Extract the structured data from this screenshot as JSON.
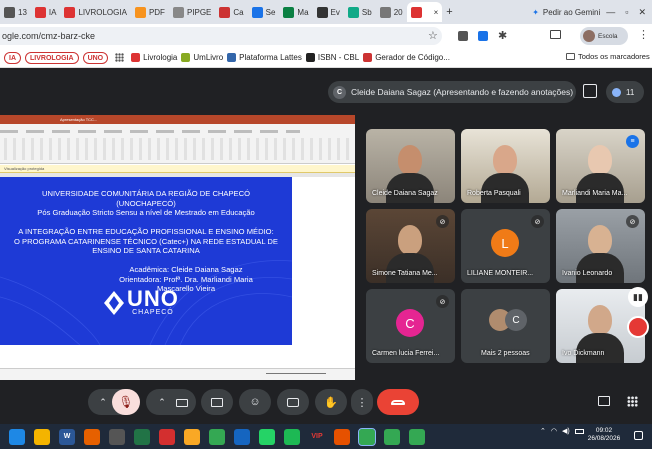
{
  "browser": {
    "tabs": [
      {
        "label": "13",
        "color": "#555"
      },
      {
        "label": "IA",
        "color": "#d33"
      },
      {
        "label": "LIVROLOGIA",
        "color": "#d33"
      },
      {
        "label": "PDF",
        "color": "#f7931e"
      },
      {
        "label": "PIPGE",
        "color": "#888"
      },
      {
        "label": "Ca",
        "color": "#c33"
      },
      {
        "label": "Se",
        "color": "#1a73e8"
      },
      {
        "label": "Ma",
        "color": "#0b8043"
      },
      {
        "label": "Ev",
        "color": "#333"
      },
      {
        "label": "Sb",
        "color": "#1a8"
      },
      {
        "label": "20",
        "color": "#777"
      },
      {
        "label": "",
        "color": "#d33"
      }
    ],
    "gemini_label": "Pedir ao Gemini",
    "url": "ogle.com/cmz-barz-cke",
    "profile_label": "Escola",
    "bookmarks": [
      {
        "label": "IA",
        "type": "pill"
      },
      {
        "label": "LIVROLOGIA",
        "type": "pill"
      },
      {
        "label": "UNO",
        "type": "pill"
      },
      {
        "label": "Livrologia",
        "color": "#d33"
      },
      {
        "label": "UmLivro",
        "color": "#8a2"
      },
      {
        "label": "Plataforma Lattes",
        "color": "#36a"
      },
      {
        "label": "ISBN - CBL",
        "color": "#222"
      },
      {
        "label": "Gerador de Código...",
        "color": "#c33"
      }
    ],
    "all_bookmarks_label": "Todos os marcadores"
  },
  "meet": {
    "presenter_initial": "C",
    "presenter_label": "Cleide Daiana Sagaz (Apresentando e fazendo anotações)",
    "participant_count": "11",
    "participants": [
      {
        "name": "Cleide Daiana Sagaz",
        "type": "video",
        "muted": false
      },
      {
        "name": "Roberta Pasquali",
        "type": "video",
        "muted": false
      },
      {
        "name": "Marliandi Maria Ma...",
        "type": "video",
        "muted": false
      },
      {
        "name": "Simone Tatiana Me...",
        "type": "video",
        "muted": true
      },
      {
        "name": "LILIANE MONTEIR...",
        "type": "avatar",
        "initial": "L",
        "avatar_color": "#f07b17",
        "muted": true
      },
      {
        "name": "Ivanio Leonardo",
        "type": "video",
        "muted": true
      },
      {
        "name": "Carmen lucia Ferrei...",
        "type": "avatar",
        "initial": "C",
        "avatar_color": "#e52592",
        "muted": true
      },
      {
        "name": "Mais 2 pessoas",
        "type": "more",
        "initial": "C"
      },
      {
        "name": "Ivo Dickmann",
        "type": "video",
        "muted": false
      }
    ]
  },
  "ppt": {
    "window_title": "Apresentação TCC...",
    "notice": "Visualização protegida",
    "slide_lines": [
      "UNIVERSIDADE COMUNITÁRIA DA REGIÃO DE CHAPECÓ",
      "(UNOCHAPECÓ)",
      "Pós Graduação Stricto Sensu a nível de Mestrado em Educação",
      "",
      "A INTEGRAÇÃO ENTRE EDUCAÇÃO PROFISSIONAL E ENSINO MÉDIO:",
      "O PROGRAMA CATARINENSE TÉCNICO (Catec+) NA REDE ESTADUAL DE",
      "ENSINO DE SANTA CATARINA",
      "",
      "Acadêmica: Cleide Daiana Sagaz",
      "Orientadora: Profª. Dra. Marliandi Maria",
      "Mascarello Vieira"
    ],
    "logo_text": "UNO",
    "logo_sub": "CHAPECÓ"
  },
  "taskbar": {
    "time": "09:02",
    "date": "26/08/2026",
    "icons": [
      {
        "name": "windows-start-icon",
        "color": "#1e88e5",
        "label": ""
      },
      {
        "name": "store-icon",
        "color": "#f4b400",
        "label": ""
      },
      {
        "name": "word-icon",
        "color": "#2b5797",
        "label": "W"
      },
      {
        "name": "firefox-icon",
        "color": "#e66000",
        "label": ""
      },
      {
        "name": "calculator-icon",
        "color": "#555",
        "label": ""
      },
      {
        "name": "excel-icon",
        "color": "#217346",
        "label": ""
      },
      {
        "name": "acrobat-icon",
        "color": "#d32f2f",
        "label": ""
      },
      {
        "name": "explorer-icon",
        "color": "#f9a825",
        "label": ""
      },
      {
        "name": "chrome-icon",
        "color": "#34a853",
        "label": ""
      },
      {
        "name": "snipping-icon",
        "color": "#1565c0",
        "label": ""
      },
      {
        "name": "whatsapp-icon",
        "color": "#25d366",
        "label": ""
      },
      {
        "name": "spotify-icon",
        "color": "#1db954",
        "label": ""
      },
      {
        "name": "vip-icon",
        "color": "#1f2a3a",
        "label": "VIP"
      },
      {
        "name": "app-icon",
        "color": "#e65100",
        "label": ""
      },
      {
        "name": "chrome-active-icon",
        "color": "#34a853",
        "label": ""
      },
      {
        "name": "chrome-2-icon",
        "color": "#34a853",
        "label": ""
      },
      {
        "name": "chrome-3-icon",
        "color": "#34a853",
        "label": ""
      }
    ]
  }
}
